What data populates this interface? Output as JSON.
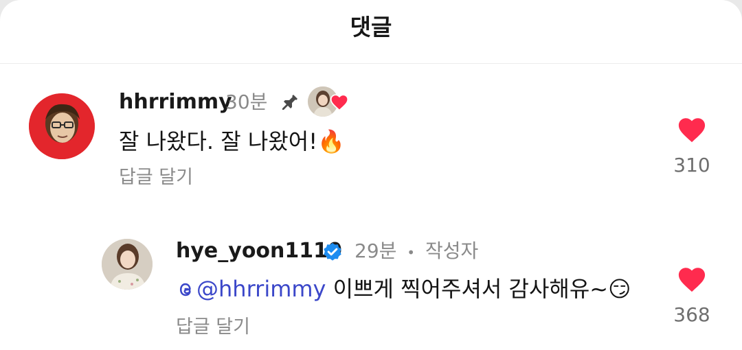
{
  "header": {
    "title": "댓글"
  },
  "comments": [
    {
      "username": "hhrrimmy",
      "time": "30분",
      "text": "잘 나왔다. 잘 나왔어!",
      "emoji": "🔥",
      "reply_label": "답글 달기",
      "like_count": "310",
      "pinned": true,
      "creator_liked": true
    },
    {
      "username": "hye_yoon1110",
      "time": "29분",
      "separator": "•",
      "author_tag": "작성자",
      "mention": "@hhrrimmy",
      "text": "이쁘게 찍어주셔서 감사해유~",
      "emoji": "😏",
      "reply_label": "답글 달기",
      "like_count": "368",
      "verified": true
    }
  ],
  "colors": {
    "like": "#ff2b4e",
    "verified": "#1d8cf0",
    "mention": "#3b47c9"
  }
}
